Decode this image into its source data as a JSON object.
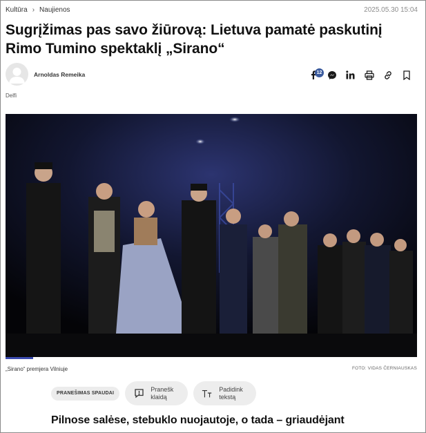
{
  "breadcrumb": {
    "items": [
      "Kultūra",
      "Naujienos"
    ],
    "separator": "›"
  },
  "article": {
    "date": "2025.05.30 15:04",
    "title": "Sugrįžimas pas savo žiūrovą: Lietuva pamatė paskutinį Rimo Tumino spektaklį „Sirano“",
    "author": "Arnoldas Remeika",
    "source": "Delfi",
    "caption": "„Sirano“ premjera Vilniuje",
    "photo_credit": "FOTO: VIDAS ČERNIAUSKAS",
    "subheading": "Pilnose salėse, stebuklo nuojautoje, o tada – griaudėjant"
  },
  "share": {
    "facebook_count": "12",
    "icons": [
      "facebook-icon",
      "messenger-icon",
      "linkedin-icon",
      "print-icon",
      "link-icon",
      "bookmark-icon"
    ]
  },
  "actions": {
    "press_tag": "PRANEŠIMAS SPAUDAI",
    "report_label": "Pranešk klaidą",
    "enlarge_label": "Padidink tekstą"
  },
  "colors": {
    "accent": "#3a4ab0",
    "badge": "#3b5b9e",
    "pill_bg": "#ededed"
  }
}
